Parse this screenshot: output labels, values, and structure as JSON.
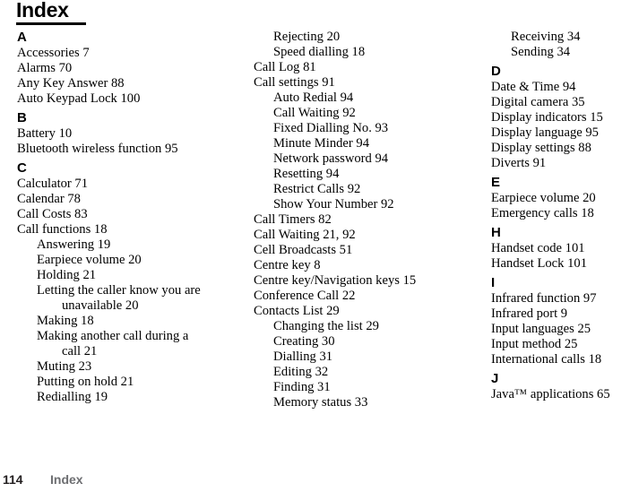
{
  "title": "Index",
  "footer": {
    "page_number": "114",
    "section_label": "Index"
  },
  "columns": [
    {
      "id": "column-1",
      "blocks": [
        {
          "type": "letter",
          "text": "A"
        },
        {
          "type": "entry",
          "level": 0,
          "text": "Accessories 7"
        },
        {
          "type": "entry",
          "level": 0,
          "text": "Alarms 70"
        },
        {
          "type": "entry",
          "level": 0,
          "text": "Any Key Answer 88"
        },
        {
          "type": "entry",
          "level": 0,
          "text": "Auto Keypad Lock 100"
        },
        {
          "type": "letter",
          "text": "B"
        },
        {
          "type": "entry",
          "level": 0,
          "text": "Battery 10"
        },
        {
          "type": "entry",
          "level": 0,
          "text": "Bluetooth wireless function 95"
        },
        {
          "type": "letter",
          "text": "C"
        },
        {
          "type": "entry",
          "level": 0,
          "text": "Calculator 71"
        },
        {
          "type": "entry",
          "level": 0,
          "text": "Calendar 78"
        },
        {
          "type": "entry",
          "level": 0,
          "text": "Call Costs 83"
        },
        {
          "type": "entry",
          "level": 0,
          "text": "Call functions 18"
        },
        {
          "type": "entry",
          "level": 1,
          "text": "Answering 19"
        },
        {
          "type": "entry",
          "level": 1,
          "text": "Earpiece volume 20"
        },
        {
          "type": "entry",
          "level": 1,
          "text": "Holding 21"
        },
        {
          "type": "entry",
          "level": 1,
          "wrap": true,
          "text": "Letting the caller know you are unavailable 20"
        },
        {
          "type": "entry",
          "level": 1,
          "text": "Making 18"
        },
        {
          "type": "entry",
          "level": 1,
          "wrap": true,
          "text": "Making another call during a call 21"
        },
        {
          "type": "entry",
          "level": 1,
          "text": "Muting 23"
        },
        {
          "type": "entry",
          "level": 1,
          "text": "Putting on hold 21"
        },
        {
          "type": "entry",
          "level": 1,
          "text": "Redialling 19"
        }
      ]
    },
    {
      "id": "column-2",
      "blocks": [
        {
          "type": "entry",
          "level": 1,
          "text": "Rejecting 20"
        },
        {
          "type": "entry",
          "level": 1,
          "text": "Speed dialling 18"
        },
        {
          "type": "entry",
          "level": 0,
          "text": "Call Log 81"
        },
        {
          "type": "entry",
          "level": 0,
          "text": "Call settings 91"
        },
        {
          "type": "entry",
          "level": 1,
          "text": "Auto Redial 94"
        },
        {
          "type": "entry",
          "level": 1,
          "text": "Call Waiting 92"
        },
        {
          "type": "entry",
          "level": 1,
          "text": "Fixed Dialling No. 93"
        },
        {
          "type": "entry",
          "level": 1,
          "text": "Minute Minder 94"
        },
        {
          "type": "entry",
          "level": 1,
          "text": "Network password 94"
        },
        {
          "type": "entry",
          "level": 1,
          "text": "Resetting 94"
        },
        {
          "type": "entry",
          "level": 1,
          "text": "Restrict Calls 92"
        },
        {
          "type": "entry",
          "level": 1,
          "text": "Show Your Number 92"
        },
        {
          "type": "entry",
          "level": 0,
          "text": "Call Timers 82"
        },
        {
          "type": "entry",
          "level": 0,
          "text": "Call Waiting 21, 92"
        },
        {
          "type": "entry",
          "level": 0,
          "text": "Cell Broadcasts 51"
        },
        {
          "type": "entry",
          "level": 0,
          "text": "Centre key 8"
        },
        {
          "type": "entry",
          "level": 0,
          "text": "Centre key/Navigation keys 15"
        },
        {
          "type": "entry",
          "level": 0,
          "text": "Conference Call 22"
        },
        {
          "type": "entry",
          "level": 0,
          "text": "Contacts List 29"
        },
        {
          "type": "entry",
          "level": 1,
          "text": "Changing the list 29"
        },
        {
          "type": "entry",
          "level": 1,
          "text": "Creating 30"
        },
        {
          "type": "entry",
          "level": 1,
          "text": "Dialling 31"
        },
        {
          "type": "entry",
          "level": 1,
          "text": "Editing 32"
        },
        {
          "type": "entry",
          "level": 1,
          "text": "Finding 31"
        },
        {
          "type": "entry",
          "level": 1,
          "text": "Memory status 33"
        }
      ]
    },
    {
      "id": "column-3",
      "blocks": [
        {
          "type": "entry",
          "level": 1,
          "text": "Receiving 34"
        },
        {
          "type": "entry",
          "level": 1,
          "text": "Sending 34"
        },
        {
          "type": "letter",
          "text": "D"
        },
        {
          "type": "entry",
          "level": 0,
          "text": "Date & Time 94"
        },
        {
          "type": "entry",
          "level": 0,
          "text": "Digital camera 35"
        },
        {
          "type": "entry",
          "level": 0,
          "text": "Display indicators 15"
        },
        {
          "type": "entry",
          "level": 0,
          "text": "Display language 95"
        },
        {
          "type": "entry",
          "level": 0,
          "text": "Display settings 88"
        },
        {
          "type": "entry",
          "level": 0,
          "text": "Diverts 91"
        },
        {
          "type": "letter",
          "text": "E"
        },
        {
          "type": "entry",
          "level": 0,
          "text": "Earpiece volume 20"
        },
        {
          "type": "entry",
          "level": 0,
          "text": "Emergency calls 18"
        },
        {
          "type": "letter",
          "text": "H"
        },
        {
          "type": "entry",
          "level": 0,
          "text": "Handset code 101"
        },
        {
          "type": "entry",
          "level": 0,
          "text": "Handset Lock 101"
        },
        {
          "type": "letter",
          "text": "I"
        },
        {
          "type": "entry",
          "level": 0,
          "text": "Infrared function 97"
        },
        {
          "type": "entry",
          "level": 0,
          "text": "Infrared port 9"
        },
        {
          "type": "entry",
          "level": 0,
          "text": "Input languages 25"
        },
        {
          "type": "entry",
          "level": 0,
          "text": "Input method 25"
        },
        {
          "type": "entry",
          "level": 0,
          "text": "International calls 18"
        },
        {
          "type": "letter",
          "text": "J"
        },
        {
          "type": "entry",
          "level": 0,
          "text": "Java™ applications 65"
        }
      ]
    }
  ]
}
